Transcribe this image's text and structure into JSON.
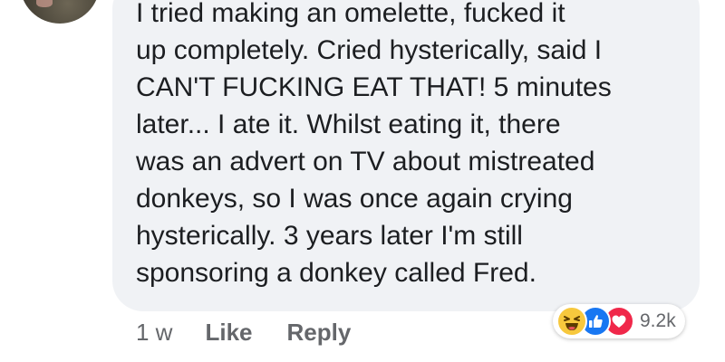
{
  "comment": {
    "lines": [
      "I tried making an omelette, fucked it",
      "up completely. Cried hysterically, said I",
      "CAN'T FUCKING EAT THAT! 5 minutes",
      "later... I ate it. Whilst eating it, there",
      "was an advert on TV about mistreated",
      "donkeys, so I was once again crying",
      "hysterically. 3 years later I'm still",
      "sponsoring a donkey called Fred."
    ]
  },
  "actions": {
    "time": "1 w",
    "like_label": "Like",
    "reply_label": "Reply"
  },
  "reactions": {
    "icons": [
      "haha-icon",
      "like-icon",
      "love-icon"
    ],
    "count": "9.2k",
    "colors": {
      "haha": "#f7c83d",
      "like": "#1877f2",
      "love": "#f0284a"
    }
  },
  "colors": {
    "bubble": "#f0f2f5",
    "text": "#1c1e21",
    "secondary_text": "#65676b"
  }
}
